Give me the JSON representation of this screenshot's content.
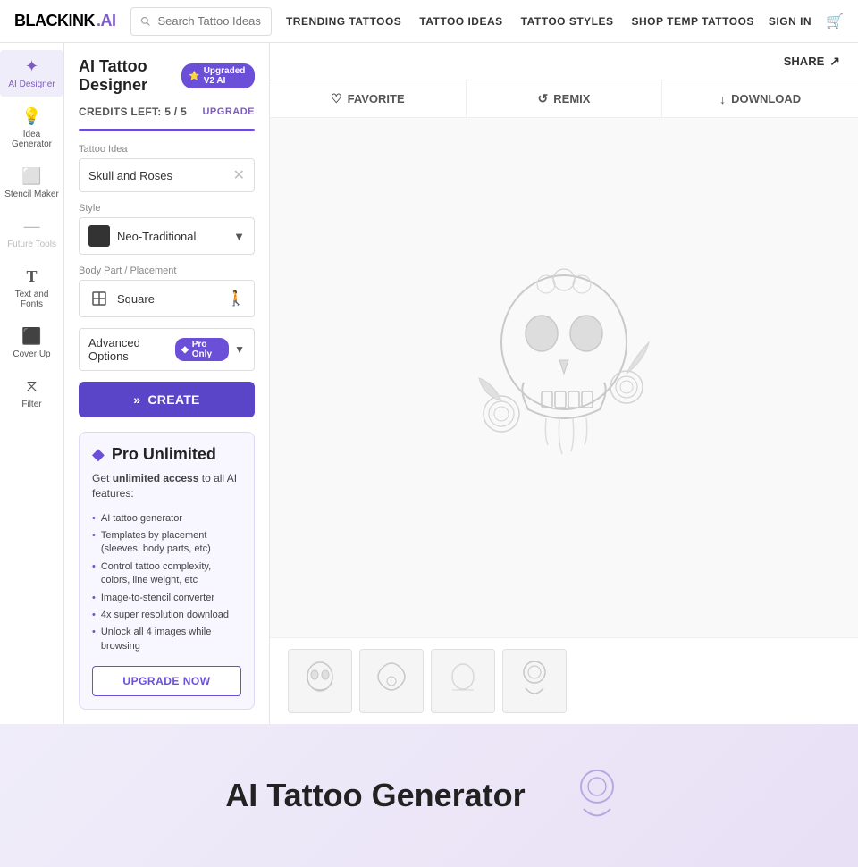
{
  "nav": {
    "logo": "BLACKINK",
    "logo_suffix": ".AI",
    "search_placeholder": "Search Tattoo Ideas",
    "links": [
      {
        "label": "TRENDING TATTOOS",
        "id": "trending"
      },
      {
        "label": "TATTOO IDEAS",
        "id": "ideas"
      },
      {
        "label": "TATTOO STYLES",
        "id": "styles"
      },
      {
        "label": "SHOP TEMP TATTOOS",
        "id": "shop"
      }
    ],
    "sign_in": "SIGN IN",
    "cart_icon": "🛒"
  },
  "sidebar": {
    "items": [
      {
        "id": "ai-designer",
        "label": "AI Designer",
        "icon": "✦",
        "active": true
      },
      {
        "id": "idea-generator",
        "label": "Idea Generator",
        "icon": "💡",
        "active": false
      },
      {
        "id": "stencil-maker",
        "label": "Stencil Maker",
        "icon": "⬜",
        "active": false
      },
      {
        "id": "future-tools",
        "label": "Future Tools",
        "icon": "",
        "active": false,
        "disabled": true
      },
      {
        "id": "text-and-fonts",
        "label": "Text and Fonts",
        "icon": "T",
        "active": false
      },
      {
        "id": "cover-up",
        "label": "Cover Up",
        "icon": "⬛",
        "active": false
      },
      {
        "id": "filter",
        "label": "Filter",
        "icon": "⧖",
        "active": false
      }
    ]
  },
  "panel": {
    "title": "AI Tattoo Designer",
    "badge": "Upgraded V2 AI",
    "credits_label": "CREDITS LEFT: 5 / 5",
    "upgrade_link": "UPGRADE",
    "credits_value": 5,
    "credits_max": 5,
    "fields": {
      "tattoo_idea_label": "Tattoo Idea",
      "tattoo_idea_value": "Skull and Roses",
      "style_label": "Style",
      "style_value": "Neo-Traditional",
      "body_placement_label": "Body Part / Placement",
      "body_placement_value": "Square"
    },
    "advanced_options_label": "Advanced Options",
    "pro_only_label": "Pro Only",
    "create_button": "CREATE",
    "pro_card": {
      "title": "Pro Unlimited",
      "subtitle_plain": "Get ",
      "subtitle_bold": "unlimited access",
      "subtitle_rest": " to all AI features:",
      "features": [
        "AI tattoo generator",
        "Templates by placement (sleeves, body parts, etc)",
        "Control tattoo complexity, colors, line weight, etc",
        "Image-to-stencil converter",
        "4x super resolution download",
        "Unlock all 4 images while browsing"
      ],
      "upgrade_button": "UPGRADE NOW"
    }
  },
  "preview": {
    "share_label": "SHARE",
    "actions": [
      {
        "id": "favorite",
        "label": "FAVORITE",
        "icon": "♡"
      },
      {
        "id": "remix",
        "label": "REMIX",
        "icon": "↺"
      },
      {
        "id": "download",
        "label": "DOWNLOAD",
        "icon": "↓"
      }
    ],
    "thumbnails": 4
  },
  "hero": {
    "title": "AI Tattoo Generator"
  }
}
